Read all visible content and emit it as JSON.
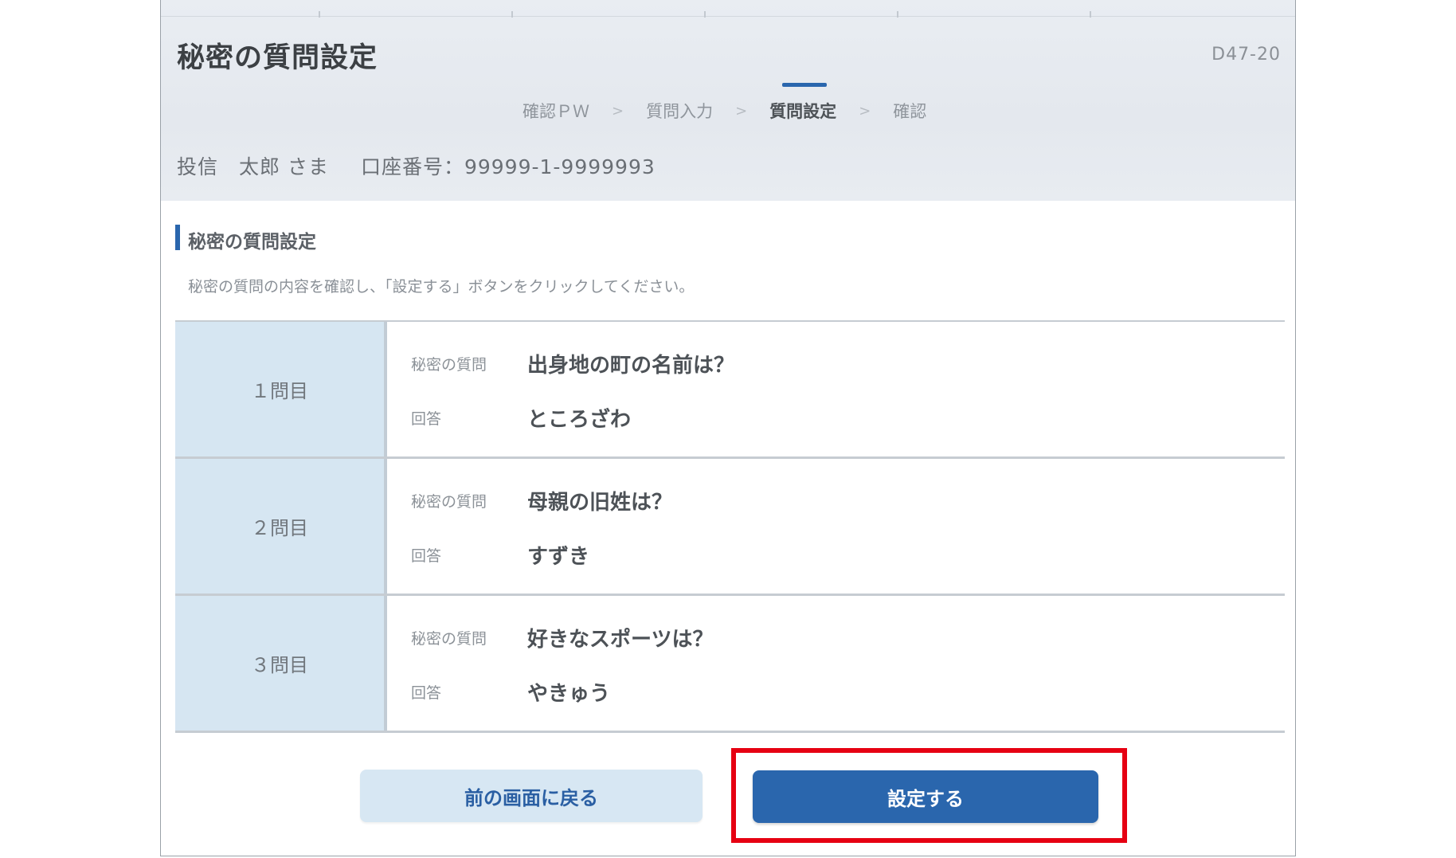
{
  "header": {
    "title": "秘密の質問設定",
    "screen_id": "D47-20"
  },
  "steps": [
    {
      "label": "確認ＰＷ",
      "active": false
    },
    {
      "label": "質問入力",
      "active": false
    },
    {
      "label": "質問設定",
      "active": true
    },
    {
      "label": "確認",
      "active": false
    }
  ],
  "step_separator": ">",
  "customer": {
    "name": "投信　太郎 さま",
    "account": "口座番号：99999-1-9999993"
  },
  "section": {
    "title": "秘密の質問設定",
    "instruction": "秘密の質問の内容を確認し、「設定する」ボタンをクリックしてください。"
  },
  "questions": [
    {
      "head": "１問目",
      "question_label": "秘密の質問",
      "question": "出身地の町の名前は？",
      "answer_label": "回答",
      "answer": "ところざわ"
    },
    {
      "head": "２問目",
      "question_label": "秘密の質問",
      "question": "母親の旧姓は？",
      "answer_label": "回答",
      "answer": "すずき"
    },
    {
      "head": "３問目",
      "question_label": "秘密の質問",
      "question": "好きなスポーツは？",
      "answer_label": "回答",
      "answer": "やきゅう"
    }
  ],
  "buttons": {
    "back": "前の画面に戻る",
    "submit": "設定する"
  },
  "colors": {
    "accent": "#2a66ad",
    "highlight": "#e60012",
    "header_cell": "#d6e6f2"
  }
}
